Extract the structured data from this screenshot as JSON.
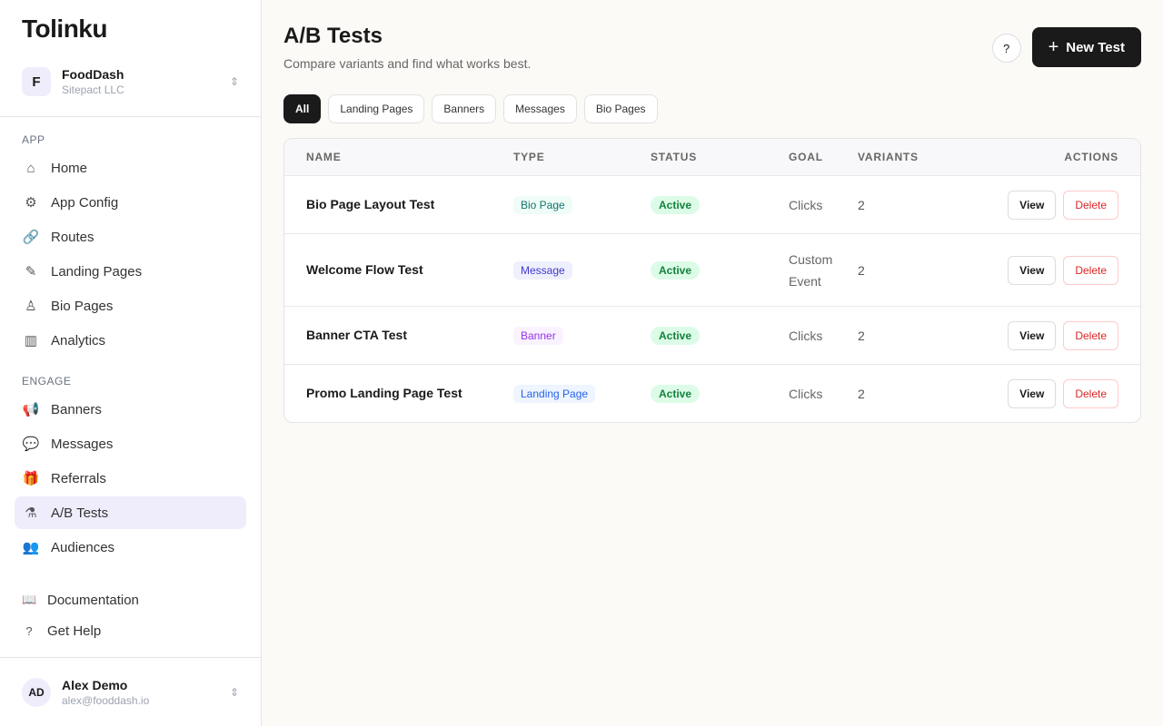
{
  "logo": "Tolinku",
  "org": {
    "initial": "F",
    "name": "FoodDash",
    "company": "Sitepact LLC"
  },
  "sections": [
    {
      "label": "APP",
      "items": [
        {
          "label": "Home",
          "icon": "⌂"
        },
        {
          "label": "App Config",
          "icon": "⚙"
        },
        {
          "label": "Routes",
          "icon": "🔗"
        },
        {
          "label": "Landing Pages",
          "icon": "✎"
        },
        {
          "label": "Bio Pages",
          "icon": "♙"
        },
        {
          "label": "Analytics",
          "icon": "▥"
        }
      ]
    },
    {
      "label": "ENGAGE",
      "items": [
        {
          "label": "Banners",
          "icon": "📢"
        },
        {
          "label": "Messages",
          "icon": "💬"
        },
        {
          "label": "Referrals",
          "icon": "🎁"
        },
        {
          "label": "A/B Tests",
          "icon": "⚗"
        },
        {
          "label": "Audiences",
          "icon": "👥"
        }
      ]
    }
  ],
  "footer": [
    {
      "label": "Documentation",
      "icon": "📖"
    },
    {
      "label": "Get Help",
      "icon": "?"
    }
  ],
  "user": {
    "initials": "AD",
    "name": "Alex Demo",
    "email": "alex@fooddash.io"
  },
  "page": {
    "title": "A/B Tests",
    "subtitle": "Compare variants and find what works best.",
    "help": "?",
    "new_button": "New Test"
  },
  "filters": [
    "All",
    "Landing Pages",
    "Banners",
    "Messages",
    "Bio Pages"
  ],
  "table": {
    "headers": [
      "NAME",
      "TYPE",
      "STATUS",
      "GOAL",
      "VARIANTS",
      "ACTIONS"
    ],
    "rows": [
      {
        "name": "Bio Page Layout Test",
        "type": "Bio Page",
        "status": "Active",
        "goal": "Clicks",
        "variants": "2",
        "view": "View",
        "delete": "Delete"
      },
      {
        "name": "Welcome Flow Test",
        "type": "Message",
        "status": "Active",
        "goal": "Custom Event",
        "variants": "2",
        "view": "View",
        "delete": "Delete"
      },
      {
        "name": "Banner CTA Test",
        "type": "Banner",
        "status": "Active",
        "goal": "Clicks",
        "variants": "2",
        "view": "View",
        "delete": "Delete"
      },
      {
        "name": "Promo Landing Page Test",
        "type": "Landing Page",
        "status": "Active",
        "goal": "Clicks",
        "variants": "2",
        "view": "View",
        "delete": "Delete"
      }
    ]
  },
  "type_colors": {
    "Bio Page": [
      "#effcf8",
      "#0f766e"
    ],
    "Message": [
      "#eef0fd",
      "#4338ca"
    ],
    "Banner": [
      "#faf3ff",
      "#9333ea"
    ],
    "Landing Page": [
      "#eff5ff",
      "#2563eb"
    ]
  }
}
